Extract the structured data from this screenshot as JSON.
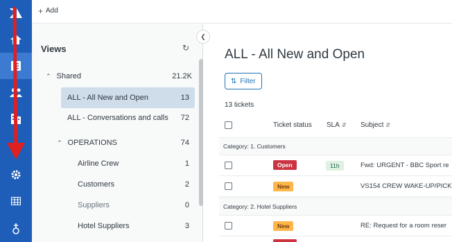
{
  "topbar": {
    "add_label": "Add"
  },
  "views": {
    "title": "Views",
    "groups": [
      {
        "label": "Shared",
        "count": "21.2K"
      }
    ],
    "items": [
      {
        "label": "ALL - All New and Open",
        "count": "13"
      },
      {
        "label": "ALL - Conversations and calls",
        "count": "72"
      }
    ],
    "subgroup": {
      "label": "OPERATIONS",
      "count": "74"
    },
    "sub_items": [
      {
        "label": "Airline Crew",
        "count": "1"
      },
      {
        "label": "Customers",
        "count": "2"
      },
      {
        "label": "Suppliers",
        "count": "0"
      },
      {
        "label": "Hotel Suppliers",
        "count": "3"
      }
    ]
  },
  "main": {
    "title": "ALL - All New and Open",
    "filter_label": "Filter",
    "tickets_count": "13 tickets",
    "columns": {
      "status": "Ticket status",
      "sla": "SLA",
      "subject": "Subject"
    },
    "categories": [
      {
        "label": "Category: 1. Customers"
      },
      {
        "label": "Category: 2. Hotel Suppliers"
      }
    ],
    "rows": [
      {
        "status": "Open",
        "sla": "11h",
        "subject": "Fwd: URGENT - BBC Sport re"
      },
      {
        "status": "New",
        "sla": "",
        "subject": "VS154 CREW WAKE-UP/PICK"
      },
      {
        "status": "New",
        "sla": "",
        "subject": "RE: Request for a room reser"
      }
    ]
  },
  "colors": {
    "rail": "#1f5eb8",
    "accent": "#1f73b7",
    "open_badge": "#cc3340",
    "new_badge": "#ffb648",
    "annotation_arrow": "#e02020"
  },
  "icons": [
    "zendesk-logo-icon",
    "home-icon",
    "views-icon",
    "customers-icon",
    "organizations-icon",
    "settings-gear-icon",
    "reporting-icon",
    "apps-icon"
  ]
}
